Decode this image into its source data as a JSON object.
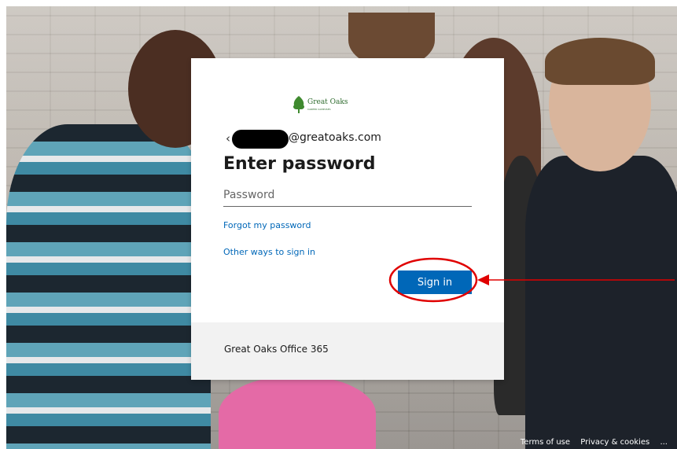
{
  "dialog": {
    "logo": {
      "name": "Great Oaks",
      "subtitle": "CAREER CAMPUSES"
    },
    "email_suffix": "@greatoaks.com",
    "back_icon": "arrow-left-icon",
    "title": "Enter password",
    "password_placeholder": "Password",
    "forgot_link": "Forgot my password",
    "other_ways_link": "Other ways to sign in",
    "signin_button": "Sign in",
    "footer_text": "Great Oaks Office 365"
  },
  "page_footer": {
    "terms": "Terms of use",
    "privacy": "Privacy & cookies",
    "more": "..."
  },
  "colors": {
    "accent": "#0067b8",
    "annotation": "#e00000"
  }
}
